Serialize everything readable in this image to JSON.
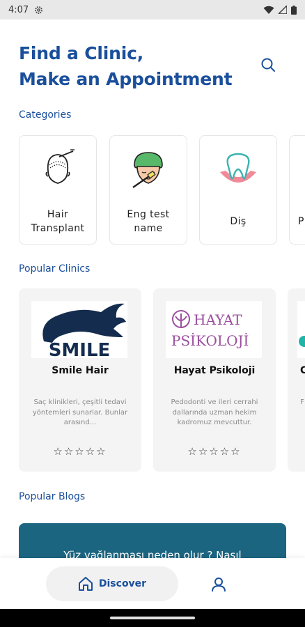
{
  "status_bar": {
    "time": "4:07"
  },
  "header": {
    "title_line1": "Find a Clinic,",
    "title_line2": "Make an Appointment"
  },
  "sections": {
    "categories": "Categories",
    "clinics": "Popular Clinics",
    "blogs": "Popular Blogs"
  },
  "categories": [
    {
      "line1": "Hair",
      "line2": "Transplant",
      "icon": "hair-transplant-icon"
    },
    {
      "line1": "Eng test",
      "line2": "name",
      "icon": "face-treatment-icon"
    },
    {
      "line1": "Diş",
      "line2": "",
      "icon": "tooth-icon"
    },
    {
      "line1": "P",
      "line2": "",
      "icon": ""
    }
  ],
  "clinics": [
    {
      "name": "Smile Hair",
      "logo_text": "SMILE",
      "description": "Saç klinikleri, çeşitli tedavi yöntemleri sunarlar. Bunlar arasınd...",
      "stars": "☆☆☆☆☆"
    },
    {
      "name": "Hayat Psikoloji",
      "logo_line1": "HAYAT",
      "logo_line2": "PSİKOLOJİ",
      "description": "Pedodonti ve ileri cerrahi dallarında uzman hekim kadromuz mevcuttur.",
      "stars": "☆☆☆☆☆"
    },
    {
      "name": "C",
      "description": "F"
    }
  ],
  "blog": {
    "title": "Yüz yağlanması neden olur ? Nasıl"
  },
  "nav": {
    "discover_label": "Discover"
  },
  "colors": {
    "primary": "#1a4f9c",
    "blog_bg": "#1c6580",
    "card_bg": "#f4f4f4"
  }
}
